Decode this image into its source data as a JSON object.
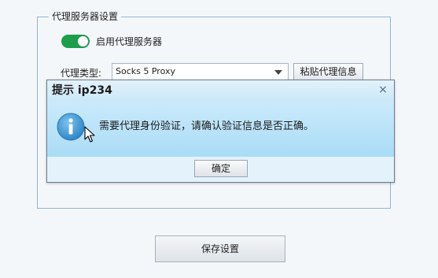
{
  "proxy_group": {
    "legend": "代理服务器设置",
    "enable_toggle": {
      "label": "启用代理服务器",
      "state": "on",
      "color": "#1e9e4a"
    },
    "type_label": "代理类型:",
    "type_select": {
      "value": "Socks 5 Proxy"
    },
    "paste_button": "粘贴代理信息"
  },
  "dialog": {
    "title": "提示 ip234",
    "close_glyph": "×",
    "icon": "info-icon",
    "message": "需要代理身份验证，请确认验证信息是否正确。",
    "ok_button": "确定"
  },
  "footer": {
    "save_button": "保存设置"
  },
  "colors": {
    "accent_green": "#1e9e4a",
    "dialog_body": "#a9dcf6",
    "info_blue": "#2e86c8"
  }
}
